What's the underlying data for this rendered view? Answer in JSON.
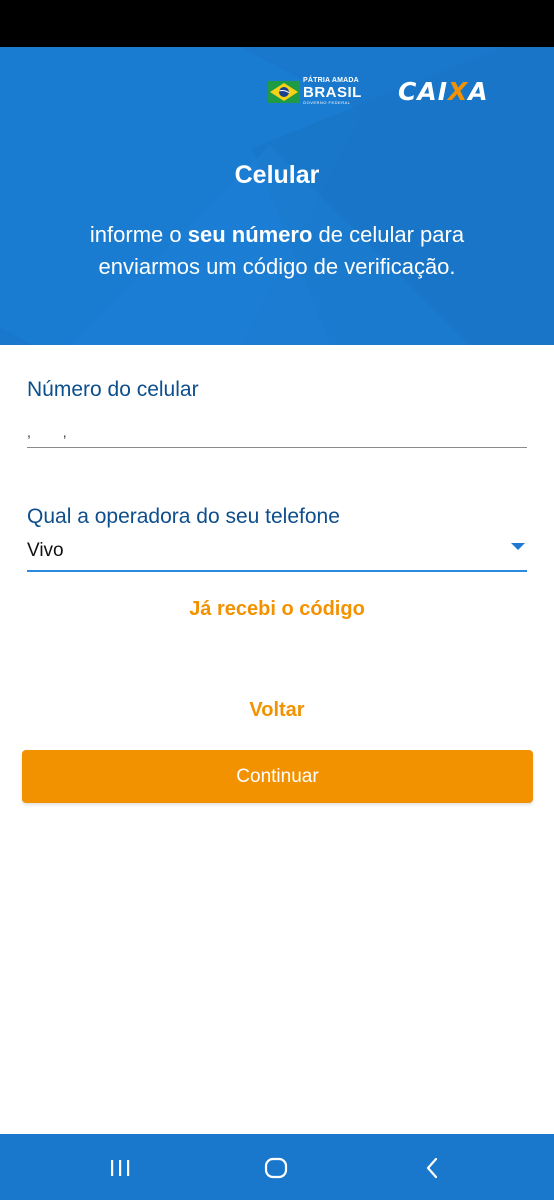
{
  "header": {
    "brand_gov_line1": "PÁTRIA AMADA",
    "brand_gov_line2": "BRASIL",
    "brand_gov_line3": "GOVERNO FEDERAL",
    "brand_caixa_a": "CAI",
    "brand_caixa_x": "X",
    "brand_caixa_b": "A",
    "title": "Celular",
    "subtitle_part1": "informe o ",
    "subtitle_bold": "seu número",
    "subtitle_part2": " de celular para enviarmos um código de verificação."
  },
  "form": {
    "phone_label": "Número do celular",
    "phone_value": ",   ,",
    "operator_label": "Qual a operadora do seu telefone",
    "operator_value": "Vivo"
  },
  "actions": {
    "already_received": "Já recebi o código",
    "back": "Voltar",
    "continue": "Continuar"
  },
  "colors": {
    "primary_blue": "#1a78cc",
    "accent_orange": "#f39200",
    "label_blue": "#0d4e8c"
  },
  "icons": {
    "nav_recent": "recent-apps-icon",
    "nav_home": "home-icon",
    "nav_back": "back-icon",
    "dropdown": "caret-down-icon"
  }
}
